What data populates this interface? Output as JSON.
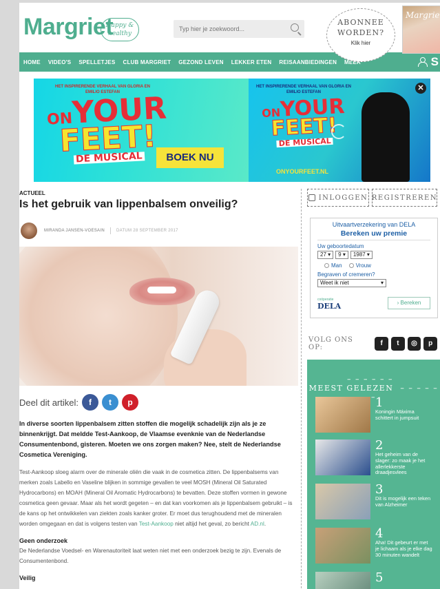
{
  "header": {
    "logo": "Margriet",
    "logo_badge": "Happy & healthy",
    "search_placeholder": "Typ hier je zoekwoord...",
    "subscribe_line1": "ABONNEE",
    "subscribe_line2": "WORDEN?",
    "subscribe_small": "Klik hier",
    "magazine_cover_title": "Margriet"
  },
  "nav": {
    "items": [
      "HOME",
      "VIDEO'S",
      "SPELLETJES",
      "CLUB MARGRIET",
      "GEZOND LEVEN",
      "LEKKER ETEN",
      "REISAANBIEDINGEN",
      "MEER"
    ],
    "s_letter": "S"
  },
  "banner": {
    "small_text": "HET INSPIRERENDE VERHAAL VAN GLORIA EN EMILIO ESTEFAN",
    "on": "ON",
    "your": "YOUR",
    "feet": "FEET!",
    "musical": "DE MUSICAL",
    "cta": "BOEK NU",
    "url": "ONYOURFEET.NL",
    "close": "✕"
  },
  "article": {
    "kicker": "ACTUEEL",
    "title": "Is het gebruik van lippenbalsem onveilig?",
    "author": "MIRANDA JANSEN-VOESAIN",
    "date": "DATUM 28 SEPTEMBER 2017",
    "share_label": "Deel dit artikel:",
    "share_fb": "f",
    "share_tw": "t",
    "share_pi": "p",
    "intro": "In diverse soorten lippenbalsem zitten stoffen die mogelijk schadelijk zijn als je ze binnenkrijgt. Dat meldde Test-Aankoop, de Vlaamse evenknie van de Nederlandse Consumentenbond, gisteren. Moeten we ons zorgen maken? Nee, stelt de Nederlandse Cosmetica Vereniging.",
    "p1_a": "Test-Aankoop sloeg alarm over de minerale oliën die vaak in de cosmetica zitten. De lippenbalsems van merken zoals Labello en Vaseline blijken in sommige gevallen te veel MOSH (Mineral Oil Saturated Hydrocarbons) en MOAH (Mineral Oil Aromatic Hydrocarbons) te bevatten. Deze stoffen vormen in gewone cosmetica geen gevaar. Maar als het wordt gegeten – en dat kan voorkomen als je lippenbalsem gebruikt – is de kans op het ontwikkelen van ziekten zoals kanker groter. Er moet dus terughoudend met de mineralen worden omgegaan en dat is volgens testen van ",
    "p1_link": "Test-Aankoop",
    "p1_b": " niet altijd het geval, zo bericht ",
    "p1_link2": "AD.nl",
    "p1_c": ".",
    "h_geen": "Geen onderzoek",
    "p2": "De Nederlandse Voedsel- en Warenautoriteit laat weten niet met een onderzoek bezig te zijn. Evenals de Consumentenbond.",
    "h_veilig": "Veilig"
  },
  "sidebar": {
    "login": "INLOGGEN",
    "register": "REGISTREREN",
    "dela_title": "Uitvaartverzekering van DELA",
    "dela_sub": "Bereken uw premie",
    "dob_label": "Uw geboortedatum",
    "dob_day": "27",
    "dob_month": "9",
    "dob_year": "1987",
    "gender_man": "Man",
    "gender_vrouw": "Vrouw",
    "q_label": "Begraven of cremeren?",
    "q_value": "Weet ik niet",
    "dela_logo_pre": "coöperatie",
    "dela_logo": "DELA",
    "bereken": "› Bereken",
    "follow_label": "VOLG ONS OP:",
    "social": [
      "f",
      "t",
      "◎",
      "p"
    ],
    "most_read_title": "MEEST GELEZEN",
    "most_read": [
      {
        "num": "1",
        "title": "Koningin Máxima schittert in jumpsuit",
        "color": "#c9a070"
      },
      {
        "num": "2",
        "title": "Het geheim van de slager: zo maak je het allerlekkerste draadjesvlees",
        "color": "#2b4f8e"
      },
      {
        "num": "3",
        "title": "Dit is mogelijk een teken van Alzheimer",
        "color": "#c8b89a"
      },
      {
        "num": "4",
        "title": "Aha! Dit gebeurt er met je lichaam als je elke dag 30 minuten wandelt",
        "color": "#a87a58"
      },
      {
        "num": "5",
        "title": "",
        "color": "#8fb0a0"
      }
    ]
  }
}
